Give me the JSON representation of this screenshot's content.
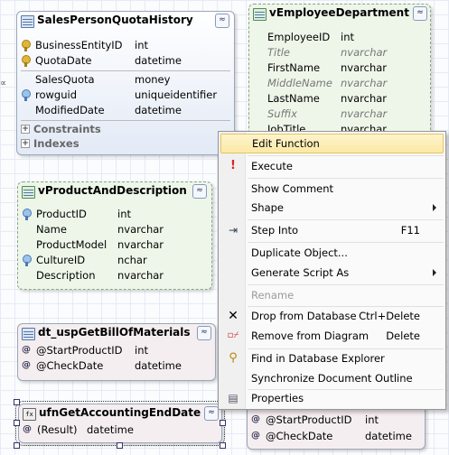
{
  "sales_quota": {
    "title": "SalesPersonQuotaHistory",
    "collapse": "≈",
    "rows": [
      {
        "name": "BusinessEntityID",
        "type": "int"
      },
      {
        "name": "QuotaDate",
        "type": "datetime"
      },
      {
        "name": "SalesQuota",
        "type": "money"
      },
      {
        "name": "rowguid",
        "type": "uniqueidentifier"
      },
      {
        "name": "ModifiedDate",
        "type": "datetime"
      }
    ],
    "sections": [
      "Constraints",
      "Indexes"
    ]
  },
  "employee_dept": {
    "title": "vEmployeeDepartment",
    "collapse": "≈",
    "rows": [
      {
        "name": "EmployeeID",
        "type": "int"
      },
      {
        "name": "Title",
        "type": "nvarchar"
      },
      {
        "name": "FirstName",
        "type": "nvarchar"
      },
      {
        "name": "MiddleName",
        "type": "nvarchar"
      },
      {
        "name": "LastName",
        "type": "nvarchar"
      },
      {
        "name": "Suffix",
        "type": "nvarchar"
      },
      {
        "name": "JobTitle",
        "type": "nvarchar"
      }
    ]
  },
  "product_desc": {
    "title": "vProductAndDescription",
    "collapse": "≈",
    "rows": [
      {
        "name": "ProductID",
        "type": "int"
      },
      {
        "name": "Name",
        "type": "nvarchar"
      },
      {
        "name": "ProductModel",
        "type": "nvarchar"
      },
      {
        "name": "CultureID",
        "type": "nchar"
      },
      {
        "name": "Description",
        "type": "nvarchar"
      }
    ]
  },
  "bill_materials": {
    "title": "dt_uspGetBillOfMaterials",
    "collapse": "≈",
    "rows": [
      {
        "name": "@StartProductID",
        "type": "int"
      },
      {
        "name": "@CheckDate",
        "type": "datetime"
      }
    ]
  },
  "accounting_end": {
    "title": "ufnGetAccountingEndDate",
    "collapse": "≈",
    "rows": [
      {
        "name": "(Result)",
        "type": "datetime"
      }
    ]
  },
  "hidden_entity": {
    "rows": [
      {
        "name": "@StartProductID",
        "type": "int"
      },
      {
        "name": "@CheckDate",
        "type": "datetime"
      }
    ]
  },
  "menu": {
    "items": [
      {
        "label": "Edit Function",
        "shortcut": "",
        "submenu": false,
        "disabled": false,
        "highlighted": true,
        "icon": ""
      },
      {
        "label": "Execute",
        "shortcut": "",
        "submenu": false,
        "disabled": false,
        "highlighted": false,
        "icon": "exclamation-icon"
      },
      {
        "label": "Show Comment",
        "shortcut": "",
        "submenu": false,
        "disabled": false,
        "highlighted": false,
        "icon": ""
      },
      {
        "label": "Shape",
        "shortcut": "",
        "submenu": true,
        "disabled": false,
        "highlighted": false,
        "icon": ""
      },
      {
        "label": "Step Into",
        "shortcut": "F11",
        "submenu": false,
        "disabled": false,
        "highlighted": false,
        "icon": "step-into-icon"
      },
      {
        "label": "Duplicate Object...",
        "shortcut": "",
        "submenu": false,
        "disabled": false,
        "highlighted": false,
        "icon": ""
      },
      {
        "label": "Generate Script As",
        "shortcut": "",
        "submenu": true,
        "disabled": false,
        "highlighted": false,
        "icon": ""
      },
      {
        "label": "Rename",
        "shortcut": "",
        "submenu": false,
        "disabled": true,
        "highlighted": false,
        "icon": ""
      },
      {
        "label": "Drop from Database",
        "shortcut": "Ctrl+Delete",
        "submenu": false,
        "disabled": false,
        "highlighted": false,
        "icon": "x-icon"
      },
      {
        "label": "Remove from Diagram",
        "shortcut": "Delete",
        "submenu": false,
        "disabled": false,
        "highlighted": false,
        "icon": "remove-diagram-icon"
      },
      {
        "label": "Find in Database Explorer",
        "shortcut": "",
        "submenu": false,
        "disabled": false,
        "highlighted": false,
        "icon": "find-icon"
      },
      {
        "label": "Synchronize Document Outline",
        "shortcut": "",
        "submenu": false,
        "disabled": false,
        "highlighted": false,
        "icon": ""
      },
      {
        "label": "Properties",
        "shortcut": "",
        "submenu": false,
        "disabled": false,
        "highlighted": false,
        "icon": "properties-icon"
      }
    ]
  },
  "colors": {
    "highlight": "#fce9a5",
    "blue_entity": "#e3eaf6",
    "view_entity": "#eef6e9",
    "routine_entity": "#f5eef0"
  }
}
